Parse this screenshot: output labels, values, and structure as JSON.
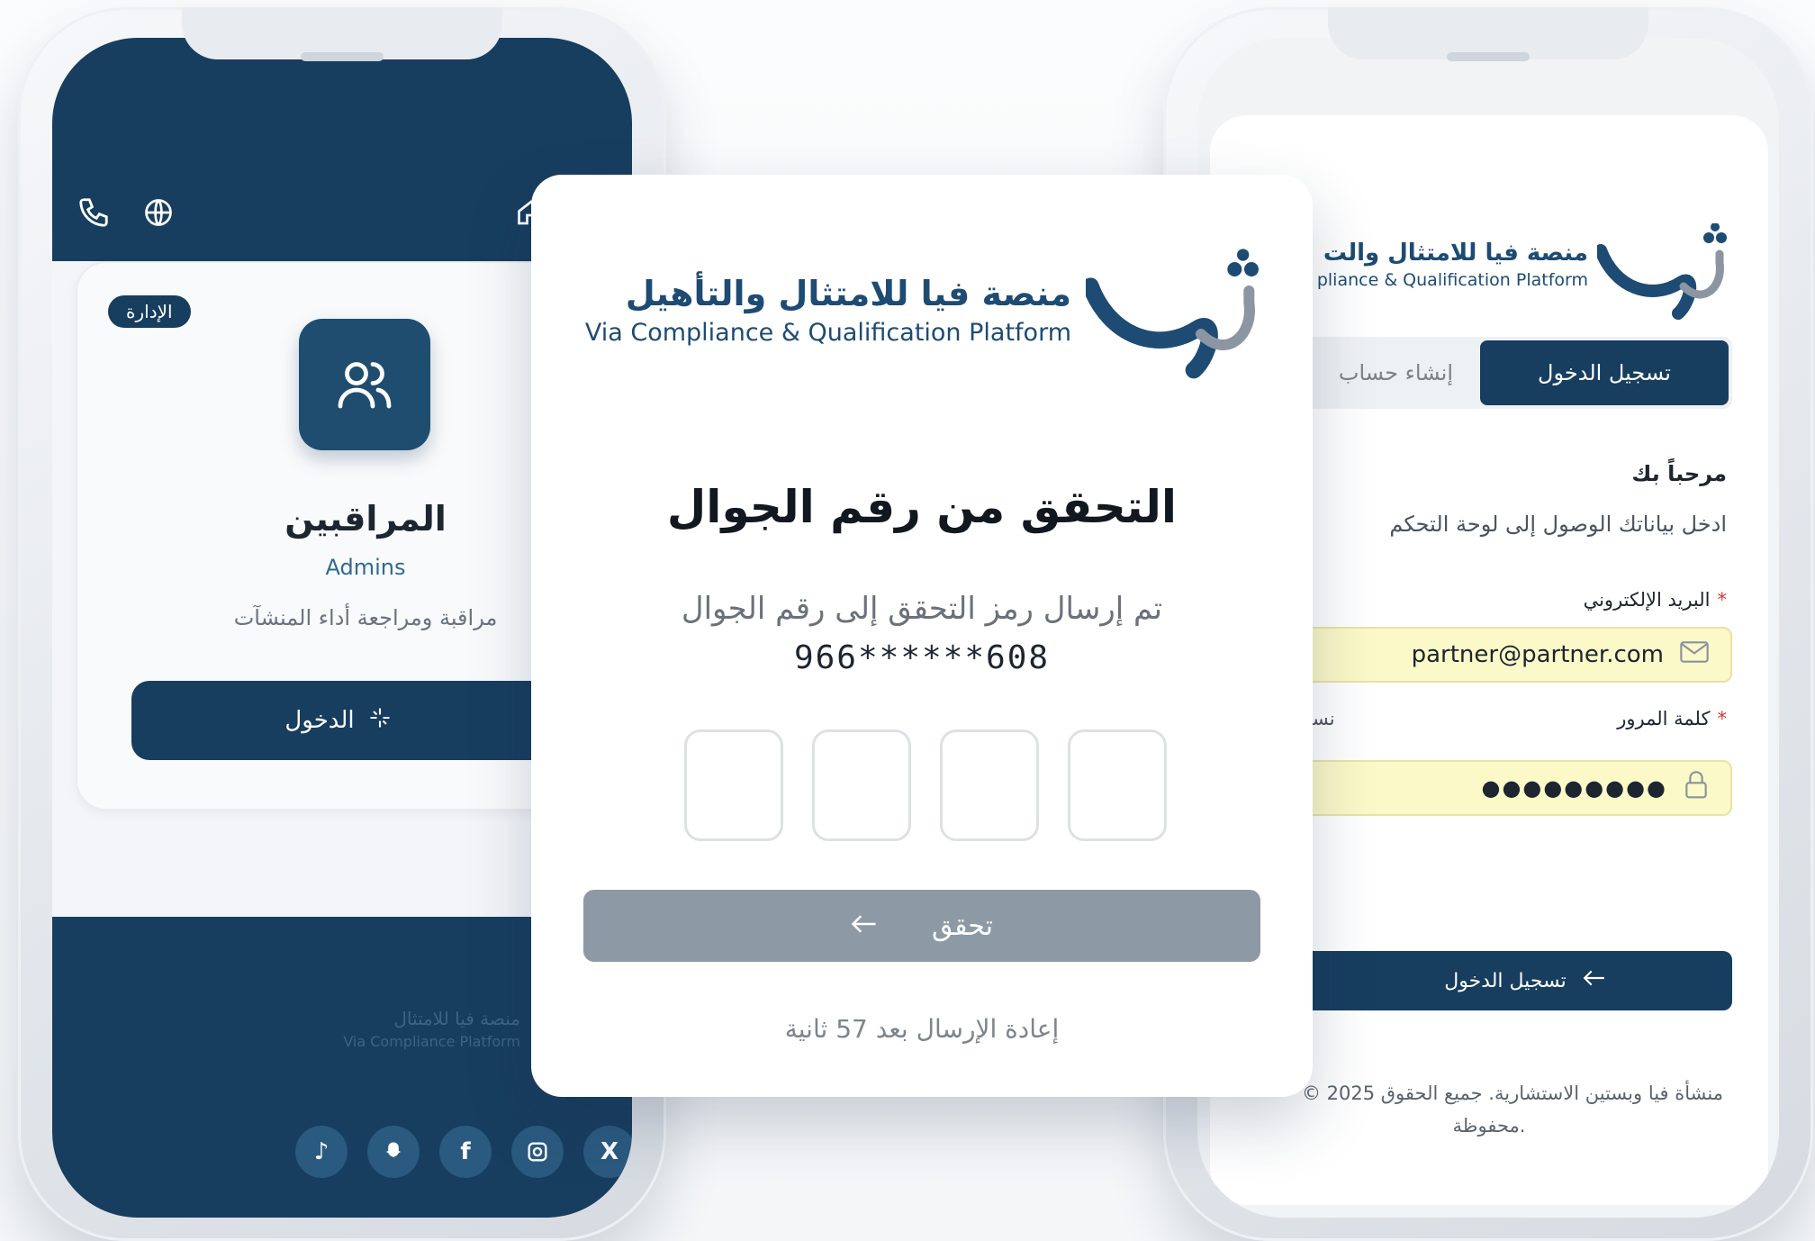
{
  "left_phone": {
    "badge": "الإدارة",
    "role_title": "المراقبين",
    "role_subtitle": "Admins",
    "role_description": "مراقبة ومراجعة أداء المنشآت",
    "login_button": "الدخول",
    "footer_logo_ar": "منصة فيا للامتثال",
    "footer_logo_en": "Via Compliance Platform",
    "social_icons": [
      "tiktok-icon",
      "snapchat-icon",
      "facebook-icon",
      "instagram-icon",
      "x-icon"
    ]
  },
  "otp_card": {
    "brand_ar": "منصة فيا للامتثال والتأهيل",
    "brand_en": "Via Compliance & Qualification Platform",
    "title": "التحقق من رقم الجوال",
    "description": "تم إرسال رمز التحقق إلى رقم الجوال",
    "masked_phone": "966******608",
    "otp_digits": [
      "",
      "",
      "",
      ""
    ],
    "verify_button": "تحقق",
    "resend_text": "إعادة الإرسال بعد 57 ثانية"
  },
  "right_phone": {
    "brand_ar": "منصة فيا للامتثال والت",
    "brand_en": "pliance & Qualification Platform",
    "tab_login": "تسجيل الدخول",
    "tab_register": "إنشاء حساب",
    "welcome": "مرحباً بك",
    "instruction": "ادخل بياناتك الوصول إلى لوحة التحكم",
    "email_label": "البريد الإلكتروني",
    "email_value": "partner@partner.com",
    "password_label": "كلمة المرور",
    "forgot_password": "نسيت كلمة",
    "password_value": "●●●●●●●●●",
    "submit_button": "تسجيل الدخول",
    "copyright_line1": "© 2025 منشأة فيا وبستين الاستشارية. جميع الحقوق",
    "copyright_line2": "محفوظة."
  },
  "colors": {
    "navy": "#173d5f",
    "brand_blue": "#1d4b73",
    "disabled_button": "#8d9aa6",
    "autofill_yellow": "#fbf9c8"
  }
}
